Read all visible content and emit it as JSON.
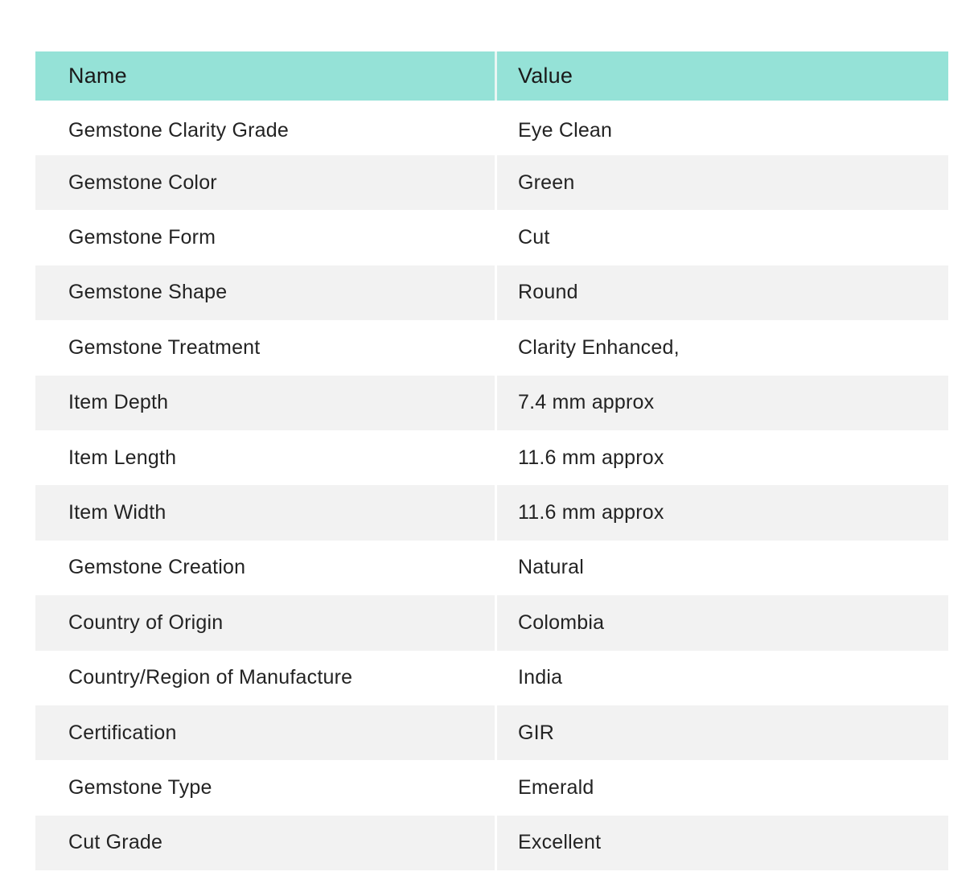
{
  "table": {
    "headers": {
      "name": "Name",
      "value": "Value"
    },
    "rows": [
      {
        "name": "Gemstone Clarity Grade",
        "value": "Eye Clean"
      },
      {
        "name": "Gemstone Color",
        "value": "Green"
      },
      {
        "name": "Gemstone Form",
        "value": "Cut"
      },
      {
        "name": "Gemstone Shape",
        "value": "Round"
      },
      {
        "name": "Gemstone Treatment",
        "value": "Clarity Enhanced,"
      },
      {
        "name": "Item Depth",
        "value": "7.4 mm approx"
      },
      {
        "name": "Item Length",
        "value": "11.6 mm approx"
      },
      {
        "name": "Item Width",
        "value": "11.6 mm approx"
      },
      {
        "name": "Gemstone Creation",
        "value": "Natural"
      },
      {
        "name": "Country of Origin",
        "value": "Colombia"
      },
      {
        "name": "Country/Region of Manufacture",
        "value": "India"
      },
      {
        "name": "Certification",
        "value": "GIR"
      },
      {
        "name": "Gemstone Type",
        "value": "Emerald"
      },
      {
        "name": "Cut Grade",
        "value": "Excellent"
      }
    ]
  },
  "colors": {
    "header_bg": "#95e2d7",
    "stripe_bg": "#f2f2f2",
    "row_bg": "#ffffff"
  }
}
